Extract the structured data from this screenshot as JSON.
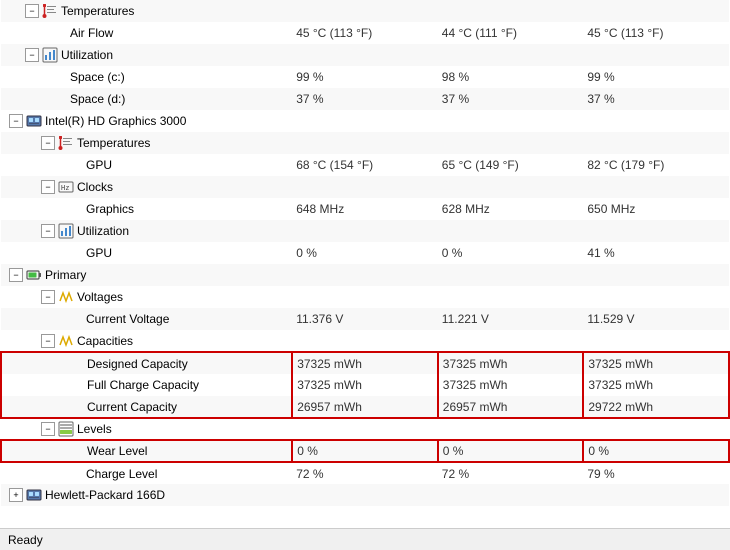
{
  "status": {
    "text": "Ready"
  },
  "tree": {
    "rows": [
      {
        "id": "temperatures-node",
        "indent": "indent-1",
        "type": "parent",
        "expanded": true,
        "icon": "temp",
        "label": "Temperatures",
        "v1": "",
        "v2": "",
        "v3": "",
        "highlight": false
      },
      {
        "id": "air-flow-row",
        "indent": "indent-3",
        "type": "leaf",
        "label": "Air Flow",
        "v1": "45 °C (113 °F)",
        "v2": "44 °C (111 °F)",
        "v3": "45 °C (113 °F)",
        "highlight": false
      },
      {
        "id": "utilization-node",
        "indent": "indent-1",
        "type": "parent",
        "expanded": true,
        "icon": "util",
        "label": "Utilization",
        "v1": "",
        "v2": "",
        "v3": "",
        "highlight": false
      },
      {
        "id": "space-c-row",
        "indent": "indent-3",
        "type": "leaf",
        "label": "Space (c:)",
        "v1": "99 %",
        "v2": "98 %",
        "v3": "99 %",
        "highlight": false
      },
      {
        "id": "space-d-row",
        "indent": "indent-3",
        "type": "leaf",
        "label": "Space (d:)",
        "v1": "37 %",
        "v2": "37 %",
        "v3": "37 %",
        "highlight": false
      },
      {
        "id": "intel-hd-node",
        "indent": "indent-0",
        "type": "parent",
        "expanded": true,
        "icon": "gpu",
        "label": "Intel(R) HD Graphics 3000",
        "v1": "",
        "v2": "",
        "v3": "",
        "highlight": false
      },
      {
        "id": "intel-temps-node",
        "indent": "indent-2",
        "type": "parent",
        "expanded": true,
        "icon": "temp",
        "label": "Temperatures",
        "v1": "",
        "v2": "",
        "v3": "",
        "highlight": false
      },
      {
        "id": "gpu-temp-row",
        "indent": "indent-4",
        "type": "leaf",
        "label": "GPU",
        "v1": "68 °C (154 °F)",
        "v2": "65 °C (149 °F)",
        "v3": "82 °C (179 °F)",
        "highlight": false
      },
      {
        "id": "clocks-node",
        "indent": "indent-2",
        "type": "parent",
        "expanded": true,
        "icon": "clock",
        "label": "Clocks",
        "v1": "",
        "v2": "",
        "v3": "",
        "highlight": false
      },
      {
        "id": "graphics-row",
        "indent": "indent-4",
        "type": "leaf",
        "label": "Graphics",
        "v1": "648 MHz",
        "v2": "628 MHz",
        "v3": "650 MHz",
        "highlight": false
      },
      {
        "id": "intel-util-node",
        "indent": "indent-2",
        "type": "parent",
        "expanded": true,
        "icon": "util",
        "label": "Utilization",
        "v1": "",
        "v2": "",
        "v3": "",
        "highlight": false
      },
      {
        "id": "gpu-util-row",
        "indent": "indent-4",
        "type": "leaf",
        "label": "GPU",
        "v1": "0 %",
        "v2": "0 %",
        "v3": "41 %",
        "highlight": false
      },
      {
        "id": "primary-node",
        "indent": "indent-0",
        "type": "parent",
        "expanded": true,
        "icon": "battery",
        "label": "Primary",
        "v1": "",
        "v2": "",
        "v3": "",
        "highlight": false
      },
      {
        "id": "voltages-node",
        "indent": "indent-2",
        "type": "parent",
        "expanded": true,
        "icon": "voltage",
        "label": "Voltages",
        "v1": "",
        "v2": "",
        "v3": "",
        "highlight": false
      },
      {
        "id": "current-voltage-row",
        "indent": "indent-4",
        "type": "leaf",
        "label": "Current Voltage",
        "v1": "11.376 V",
        "v2": "11.221 V",
        "v3": "11.529 V",
        "highlight": false
      },
      {
        "id": "capacities-node",
        "indent": "indent-2",
        "type": "parent",
        "expanded": true,
        "icon": "voltage",
        "label": "Capacities",
        "v1": "",
        "v2": "",
        "v3": "",
        "highlight": false
      },
      {
        "id": "designed-capacity-row",
        "indent": "indent-4",
        "type": "leaf",
        "label": "Designed Capacity",
        "v1": "37325 mWh",
        "v2": "37325 mWh",
        "v3": "37325 mWh",
        "highlight": true,
        "boxTop": true,
        "boxBottom": false
      },
      {
        "id": "full-charge-row",
        "indent": "indent-4",
        "type": "leaf",
        "label": "Full Charge Capacity",
        "v1": "37325 mWh",
        "v2": "37325 mWh",
        "v3": "37325 mWh",
        "highlight": true,
        "boxTop": false,
        "boxBottom": false
      },
      {
        "id": "current-capacity-row",
        "indent": "indent-4",
        "type": "leaf",
        "label": "Current Capacity",
        "v1": "26957 mWh",
        "v2": "26957 mWh",
        "v3": "29722 mWh",
        "highlight": true,
        "boxTop": false,
        "boxBottom": true
      },
      {
        "id": "levels-node",
        "indent": "indent-2",
        "type": "parent",
        "expanded": true,
        "icon": "levels",
        "label": "Levels",
        "v1": "",
        "v2": "",
        "v3": "",
        "highlight": false
      },
      {
        "id": "wear-level-row",
        "indent": "indent-4",
        "type": "leaf",
        "label": "Wear Level",
        "v1": "0 %",
        "v2": "0 %",
        "v3": "0 %",
        "highlight": true,
        "boxTop": true,
        "boxBottom": true
      },
      {
        "id": "charge-level-row",
        "indent": "indent-4",
        "type": "leaf",
        "label": "Charge Level",
        "v1": "72 %",
        "v2": "72 %",
        "v3": "79 %",
        "highlight": false
      },
      {
        "id": "hewlett-node",
        "indent": "indent-0",
        "type": "parent",
        "expanded": false,
        "icon": "gpu",
        "label": "Hewlett-Packard 166D",
        "v1": "",
        "v2": "",
        "v3": "",
        "highlight": false
      }
    ]
  }
}
